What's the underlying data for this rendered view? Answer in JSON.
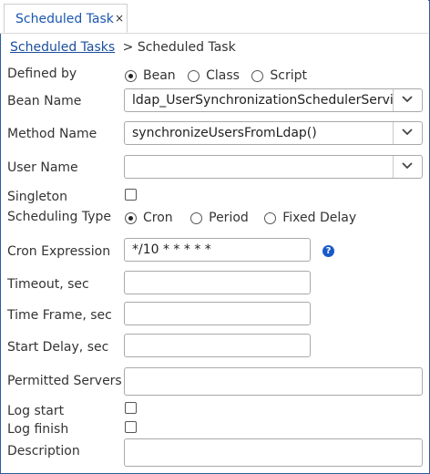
{
  "tab": {
    "label": "Scheduled Task",
    "close": "×"
  },
  "breadcrumb": {
    "link": "Scheduled Tasks",
    "separator": ">",
    "current": "Scheduled Task"
  },
  "fields": {
    "defined_by": {
      "label": "Defined by",
      "options": [
        "Bean",
        "Class",
        "Script"
      ],
      "selected": "Bean"
    },
    "bean_name": {
      "label": "Bean Name",
      "value": "ldap_UserSynchronizationSchedulerService"
    },
    "method_name": {
      "label": "Method Name",
      "value": "synchronizeUsersFromLdap()"
    },
    "user_name": {
      "label": "User Name",
      "value": ""
    },
    "singleton": {
      "label": "Singleton",
      "checked": false
    },
    "scheduling_type": {
      "label": "Scheduling Type",
      "options": [
        "Cron",
        "Period",
        "Fixed Delay"
      ],
      "selected": "Cron"
    },
    "cron_expression": {
      "label": "Cron Expression",
      "value": "*/10 * * * * *",
      "help_icon": "question-circle"
    },
    "timeout": {
      "label": "Timeout, sec",
      "value": ""
    },
    "time_frame": {
      "label": "Time Frame, sec",
      "value": ""
    },
    "start_delay": {
      "label": "Start Delay, sec",
      "value": ""
    },
    "permitted_servers": {
      "label": "Permitted Servers",
      "value": ""
    },
    "log_start": {
      "label": "Log start",
      "checked": false
    },
    "log_finish": {
      "label": "Log finish",
      "checked": false
    },
    "description": {
      "label": "Description",
      "value": ""
    }
  },
  "colors": {
    "accent": "#1a57b0",
    "frame_border": "#2a5d9f",
    "help_icon": "#1a59c9"
  }
}
